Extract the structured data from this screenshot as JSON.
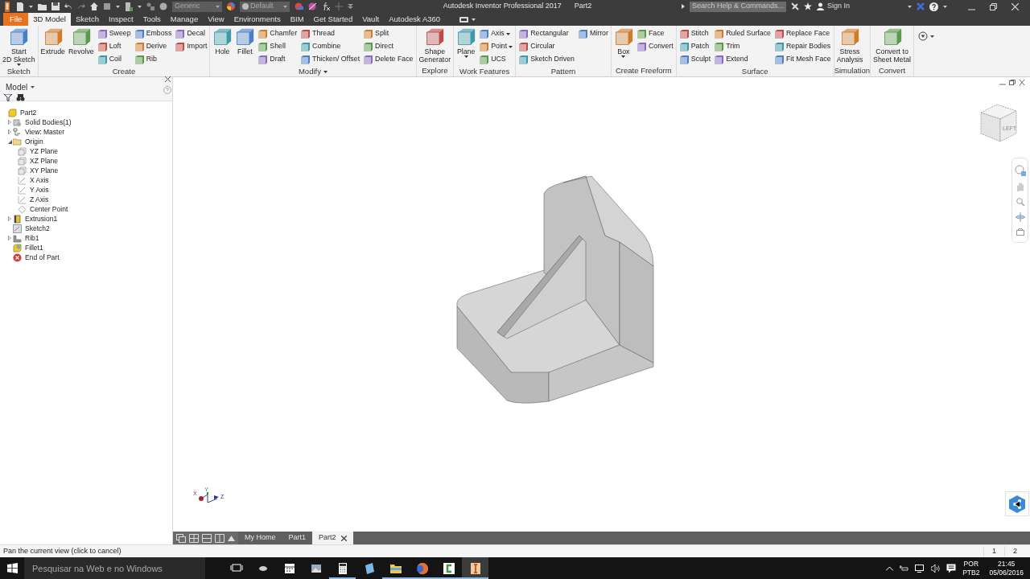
{
  "title_bar": {
    "material": "Generic",
    "appearance": "Default",
    "app_title": "Autodesk Inventor Professional 2017",
    "document": "Part2",
    "search": {
      "placeholder": "Search Help & Commands..."
    },
    "sign_in": "Sign In"
  },
  "menu_tabs": [
    {
      "label": "File",
      "kind": "file",
      "selected": false
    },
    {
      "label": "3D Model",
      "kind": "tab",
      "selected": true
    },
    {
      "label": "Sketch",
      "kind": "tab",
      "selected": false
    },
    {
      "label": "Inspect",
      "kind": "tab",
      "selected": false
    },
    {
      "label": "Tools",
      "kind": "tab",
      "selected": false
    },
    {
      "label": "Manage",
      "kind": "tab",
      "selected": false
    },
    {
      "label": "View",
      "kind": "tab",
      "selected": false
    },
    {
      "label": "Environments",
      "kind": "tab",
      "selected": false
    },
    {
      "label": "BIM",
      "kind": "tab",
      "selected": false
    },
    {
      "label": "Get Started",
      "kind": "tab",
      "selected": false
    },
    {
      "label": "Vault",
      "kind": "tab",
      "selected": false
    },
    {
      "label": "Autodesk A360",
      "kind": "tab",
      "selected": false
    }
  ],
  "ribbon": [
    {
      "title": "Sketch",
      "expandable": false,
      "large": [
        {
          "label": "Start\n2D Sketch",
          "dropdown": true
        }
      ]
    },
    {
      "title": "Create",
      "expandable": false,
      "large": [
        {
          "label": "Extrude",
          "dropdown": false
        },
        {
          "label": "Revolve",
          "dropdown": false
        }
      ],
      "columns": [
        [
          {
            "label": "Sweep",
            "dropdown": false
          },
          {
            "label": "Loft",
            "dropdown": false
          },
          {
            "label": "Coil",
            "dropdown": false
          }
        ],
        [
          {
            "label": "Emboss",
            "dropdown": false
          },
          {
            "label": "Derive",
            "dropdown": false
          },
          {
            "label": "Rib",
            "dropdown": false
          }
        ],
        [
          {
            "label": "Decal",
            "dropdown": false
          },
          {
            "label": "Import",
            "dropdown": false
          }
        ]
      ]
    },
    {
      "title": "Modify",
      "expandable": true,
      "large": [
        {
          "label": "Hole",
          "dropdown": false
        },
        {
          "label": "Fillet",
          "dropdown": false
        }
      ],
      "columns": [
        [
          {
            "label": "Chamfer",
            "dropdown": false
          },
          {
            "label": "Shell",
            "dropdown": false
          },
          {
            "label": "Draft",
            "dropdown": false
          }
        ],
        [
          {
            "label": "Thread",
            "dropdown": false
          },
          {
            "label": "Combine",
            "dropdown": false
          },
          {
            "label": "Thicken/ Offset",
            "dropdown": false
          }
        ],
        [
          {
            "label": "Split",
            "dropdown": false
          },
          {
            "label": "Direct",
            "dropdown": false
          },
          {
            "label": "Delete Face",
            "dropdown": false
          }
        ]
      ]
    },
    {
      "title": "Explore",
      "expandable": false,
      "large": [
        {
          "label": "Shape\nGenerator",
          "dropdown": false
        }
      ]
    },
    {
      "title": "Work Features",
      "expandable": false,
      "large": [
        {
          "label": "Plane",
          "dropdown": true
        }
      ],
      "columns": [
        [
          {
            "label": "Axis",
            "dropdown": true
          },
          {
            "label": "Point",
            "dropdown": true
          },
          {
            "label": "UCS",
            "dropdown": false
          }
        ]
      ]
    },
    {
      "title": "Pattern",
      "expandable": false,
      "columns": [
        [
          {
            "label": "Rectangular",
            "dropdown": false
          },
          {
            "label": "Circular",
            "dropdown": false
          },
          {
            "label": "Sketch Driven",
            "dropdown": false
          }
        ],
        [
          {
            "label": "Mirror",
            "dropdown": false
          }
        ]
      ]
    },
    {
      "title": "Create Freeform",
      "expandable": false,
      "large": [
        {
          "label": "Box",
          "dropdown": true
        }
      ],
      "columns": [
        [
          {
            "label": "Face",
            "dropdown": false
          },
          {
            "label": "Convert",
            "dropdown": false
          }
        ]
      ]
    },
    {
      "title": "Surface",
      "expandable": false,
      "columns": [
        [
          {
            "label": "Stitch",
            "dropdown": false
          },
          {
            "label": "Patch",
            "dropdown": false
          },
          {
            "label": "Sculpt",
            "dropdown": false
          }
        ],
        [
          {
            "label": "Ruled Surface",
            "dropdown": false
          },
          {
            "label": "Trim",
            "dropdown": false
          },
          {
            "label": "Extend",
            "dropdown": false
          }
        ],
        [
          {
            "label": "Replace Face",
            "dropdown": false
          },
          {
            "label": "Repair Bodies",
            "dropdown": false
          },
          {
            "label": "Fit Mesh Face",
            "dropdown": false
          }
        ]
      ]
    },
    {
      "title": "Simulation",
      "expandable": false,
      "large": [
        {
          "label": "Stress\nAnalysis",
          "dropdown": false
        }
      ]
    },
    {
      "title": "Convert",
      "expandable": false,
      "large": [
        {
          "label": "Convert to\nSheet Metal",
          "dropdown": false
        }
      ]
    }
  ],
  "browser": {
    "title": "Model",
    "tree": [
      {
        "label": "Part2",
        "kind": "part",
        "children": [
          {
            "label": "Solid Bodies(1)",
            "kind": "bodies",
            "expanded": false
          },
          {
            "label": "View: Master",
            "kind": "view",
            "expanded": false
          },
          {
            "label": "Origin",
            "kind": "folder",
            "expanded": true,
            "children": [
              {
                "label": "YZ Plane",
                "kind": "plane"
              },
              {
                "label": "XZ Plane",
                "kind": "plane"
              },
              {
                "label": "XY Plane",
                "kind": "plane"
              },
              {
                "label": "X Axis",
                "kind": "axis"
              },
              {
                "label": "Y Axis",
                "kind": "axis"
              },
              {
                "label": "Z Axis",
                "kind": "axis"
              },
              {
                "label": "Center Point",
                "kind": "point"
              }
            ]
          },
          {
            "label": "Extrusion1",
            "kind": "extrusion",
            "expanded": false
          },
          {
            "label": "Sketch2",
            "kind": "sketch"
          },
          {
            "label": "Rib1",
            "kind": "rib",
            "expanded": false
          },
          {
            "label": "Fillet1",
            "kind": "fillet"
          },
          {
            "label": "End of Part",
            "kind": "end"
          }
        ]
      }
    ]
  },
  "viewport": {
    "view_cube_face": "LEFT",
    "triad": [
      "X",
      "Y",
      "Z"
    ]
  },
  "doc_tabs": [
    {
      "label": "My Home",
      "selected": false,
      "closable": false
    },
    {
      "label": "Part1",
      "selected": false,
      "closable": false
    },
    {
      "label": "Part2",
      "selected": true,
      "closable": true
    }
  ],
  "status_bar": {
    "message": "Pan the current view (click to cancel)",
    "pages": [
      "1",
      "2"
    ]
  },
  "taskbar": {
    "search": {
      "placeholder": "Pesquisar na Web e no Windows"
    },
    "apps": [
      {
        "kind": "taskview",
        "running": false,
        "active": false
      },
      {
        "kind": "mouse",
        "running": false,
        "active": false
      },
      {
        "kind": "calendar",
        "running": false,
        "active": false
      },
      {
        "kind": "photos",
        "running": false,
        "active": false
      },
      {
        "kind": "calculator",
        "running": true,
        "active": false
      },
      {
        "kind": "tablet",
        "running": false,
        "active": false
      },
      {
        "kind": "folder",
        "running": true,
        "active": false
      },
      {
        "kind": "browser",
        "running": true,
        "active": false
      },
      {
        "kind": "recorder",
        "running": true,
        "active": false
      },
      {
        "kind": "inventor",
        "running": true,
        "active": true
      }
    ],
    "language": "POR",
    "layout": "PTB2",
    "time": "21:45",
    "date": "05/06/2016"
  }
}
